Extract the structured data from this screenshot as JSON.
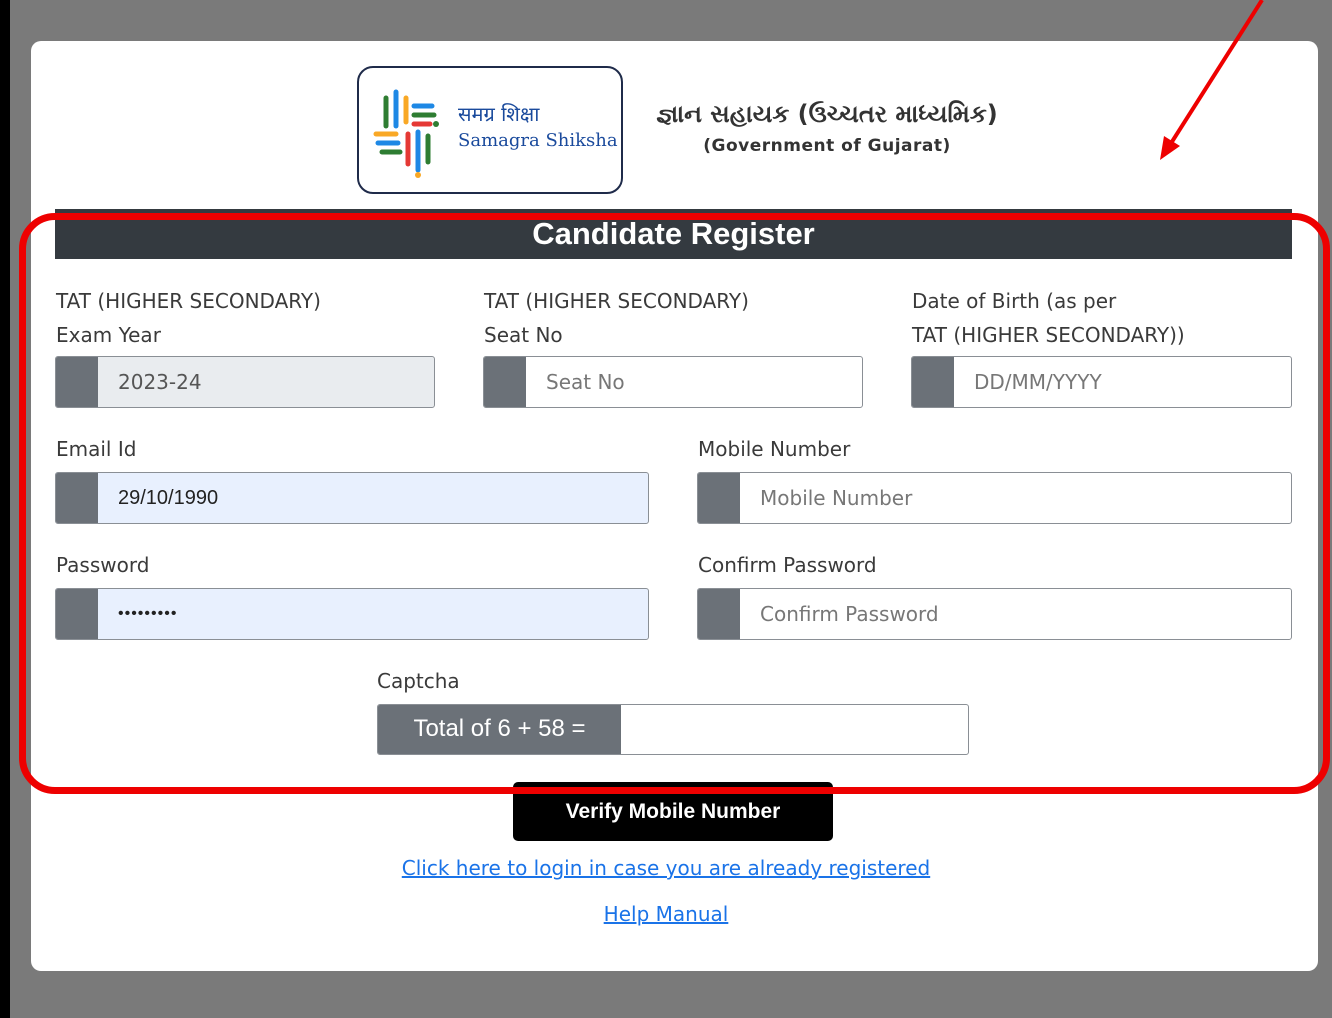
{
  "header": {
    "logo_hindi": "समग्र शिक्षा",
    "logo_english": "Samagra Shiksha",
    "title": "જ્ઞાન સહાયક (ઉચ્ચતર માધ્યમિક)",
    "subtitle": "(Government of Gujarat)"
  },
  "form": {
    "heading": "Candidate Register",
    "exam_year": {
      "label_line1": "TAT (HIGHER SECONDARY)",
      "label_line2": "Exam Year",
      "value": "2023-24"
    },
    "seat_no": {
      "label_line1": "TAT (HIGHER SECONDARY)",
      "label_line2": "Seat No",
      "placeholder": "Seat No"
    },
    "dob": {
      "label_line1": "Date of Birth (as per",
      "label_line2": "TAT (HIGHER SECONDARY))",
      "placeholder": "DD/MM/YYYY"
    },
    "email": {
      "label": "Email Id",
      "value": "29/10/1990"
    },
    "mobile": {
      "label": "Mobile Number",
      "placeholder": "Mobile Number"
    },
    "password": {
      "label": "Password",
      "value": "•••••••••"
    },
    "confirm_password": {
      "label": "Confirm Password",
      "placeholder": "Confirm Password"
    },
    "captcha": {
      "label": "Captcha",
      "question": "Total of 6 + 58 ="
    },
    "verify_button": "Verify Mobile Number",
    "login_link": "Click here to login in case you are already registered",
    "help_link": "Help Manual"
  },
  "colors": {
    "annotation": "#ee0000",
    "header_bar": "#343a40",
    "link": "#1a73e8"
  }
}
